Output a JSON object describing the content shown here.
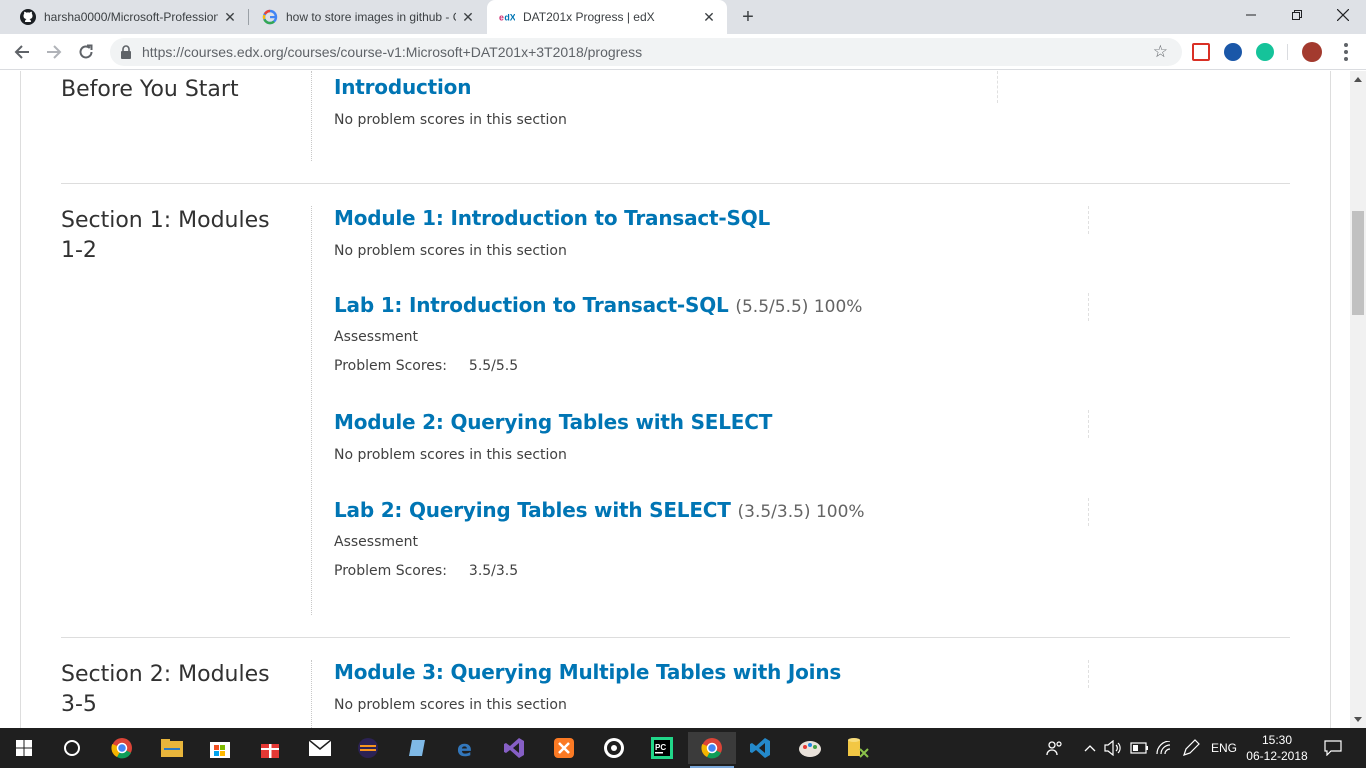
{
  "browser": {
    "tabs": [
      {
        "title": "harsha0000/Microsoft-Profession",
        "icon": "github-icon"
      },
      {
        "title": "how to store images in github - G",
        "icon": "google-icon"
      },
      {
        "title": "DAT201x Progress | edX",
        "icon": "edx-icon",
        "active": true
      }
    ],
    "url": "https://courses.edx.org/courses/course-v1:Microsoft+DAT201x+3T2018/progress"
  },
  "progress": {
    "chapters": [
      {
        "title": "Before You Start",
        "sections": [
          {
            "title": "Introduction",
            "note": "No problem scores in this section"
          }
        ]
      },
      {
        "title": "Section 1: Modules 1-2",
        "sections": [
          {
            "title": "Module 1: Introduction to Transact-SQL",
            "note": "No problem scores in this section"
          },
          {
            "title": "Lab 1: Introduction to Transact-SQL",
            "score": "(5.5/5.5) 100%",
            "format": "Assessment",
            "problem_scores_label": "Problem Scores:",
            "problem_scores": "5.5/5.5"
          },
          {
            "title": "Module 2: Querying Tables with SELECT",
            "note": "No problem scores in this section"
          },
          {
            "title": "Lab 2: Querying Tables with SELECT",
            "score": "(3.5/3.5) 100%",
            "format": "Assessment",
            "problem_scores_label": "Problem Scores:",
            "problem_scores": "3.5/3.5"
          }
        ]
      },
      {
        "title": "Section 2: Modules 3-5",
        "sections": [
          {
            "title": "Module 3: Querying Multiple Tables with Joins",
            "note": "No problem scores in this section"
          }
        ]
      }
    ]
  },
  "taskbar": {
    "language": "ENG",
    "time": "15:30",
    "date": "06-12-2018"
  },
  "colors": {
    "link": "#0075b4",
    "text": "#313131"
  }
}
